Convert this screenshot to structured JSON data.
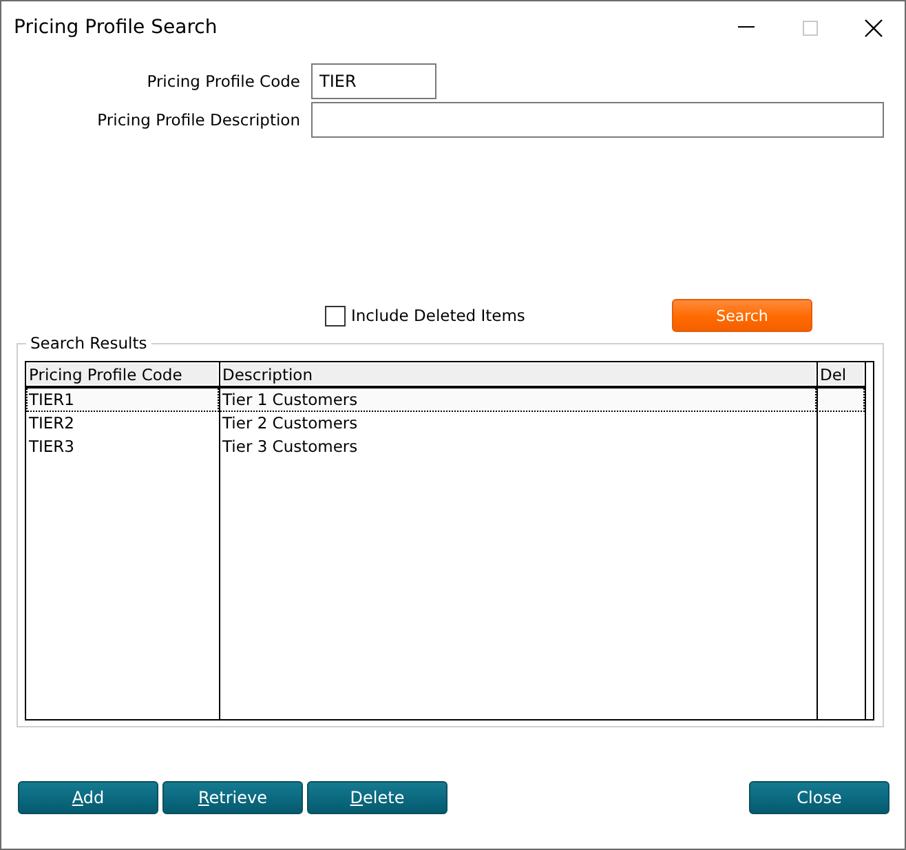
{
  "window": {
    "title": "Pricing Profile Search"
  },
  "fields": [
    {
      "label": "Pricing Profile Code",
      "value": "TIER",
      "kind": "short"
    },
    {
      "label": "Pricing Profile Description",
      "kind": "long"
    }
  ],
  "include_deleted": {
    "label": "Include Deleted Items",
    "checked": false
  },
  "search_button": {
    "label": "Search"
  },
  "results": {
    "title": "Search Results",
    "columns": [
      "Pricing Profile Code",
      "Description",
      "Del"
    ],
    "rows": [
      {
        "code": "TIER1",
        "description": "Tier 1 Customers",
        "selected": true
      },
      {
        "code": "TIER2",
        "description": "Tier 2 Customers",
        "selected": false
      },
      {
        "code": "TIER3",
        "description": "Tier 3 Customers",
        "selected": false
      }
    ]
  },
  "buttons": [
    {
      "label": "Add",
      "mnemonic_underlined": true
    },
    {
      "label": "Retrieve",
      "mnemonic_underlined": true
    },
    {
      "label": "Delete",
      "mnemonic_underlined": true
    }
  ],
  "close_button": {
    "label": "Close"
  }
}
